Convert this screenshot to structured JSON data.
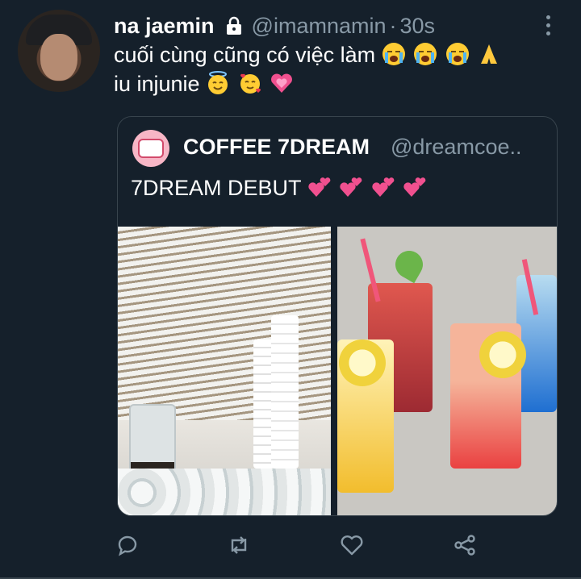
{
  "tweet": {
    "author_name": "na jaemin",
    "handle": "@imamnamin",
    "separator": "·",
    "time": "30s",
    "line1": "cuối cùng cũng có việc làm",
    "line2": "iu injunie"
  },
  "quoted_tweet": {
    "author_name": "COFFEE 7DREAM",
    "handle": "@dreamcoe..",
    "text": "7DREAM DEBUT"
  },
  "icons": {
    "lock": "lock-icon",
    "more": "more-vertical-icon",
    "reply": "reply-icon",
    "retweet": "retweet-icon",
    "like": "heart-icon",
    "share": "share-icon"
  },
  "colors": {
    "background": "#15202b",
    "secondary_text": "#8899a6",
    "border": "#38444d"
  }
}
